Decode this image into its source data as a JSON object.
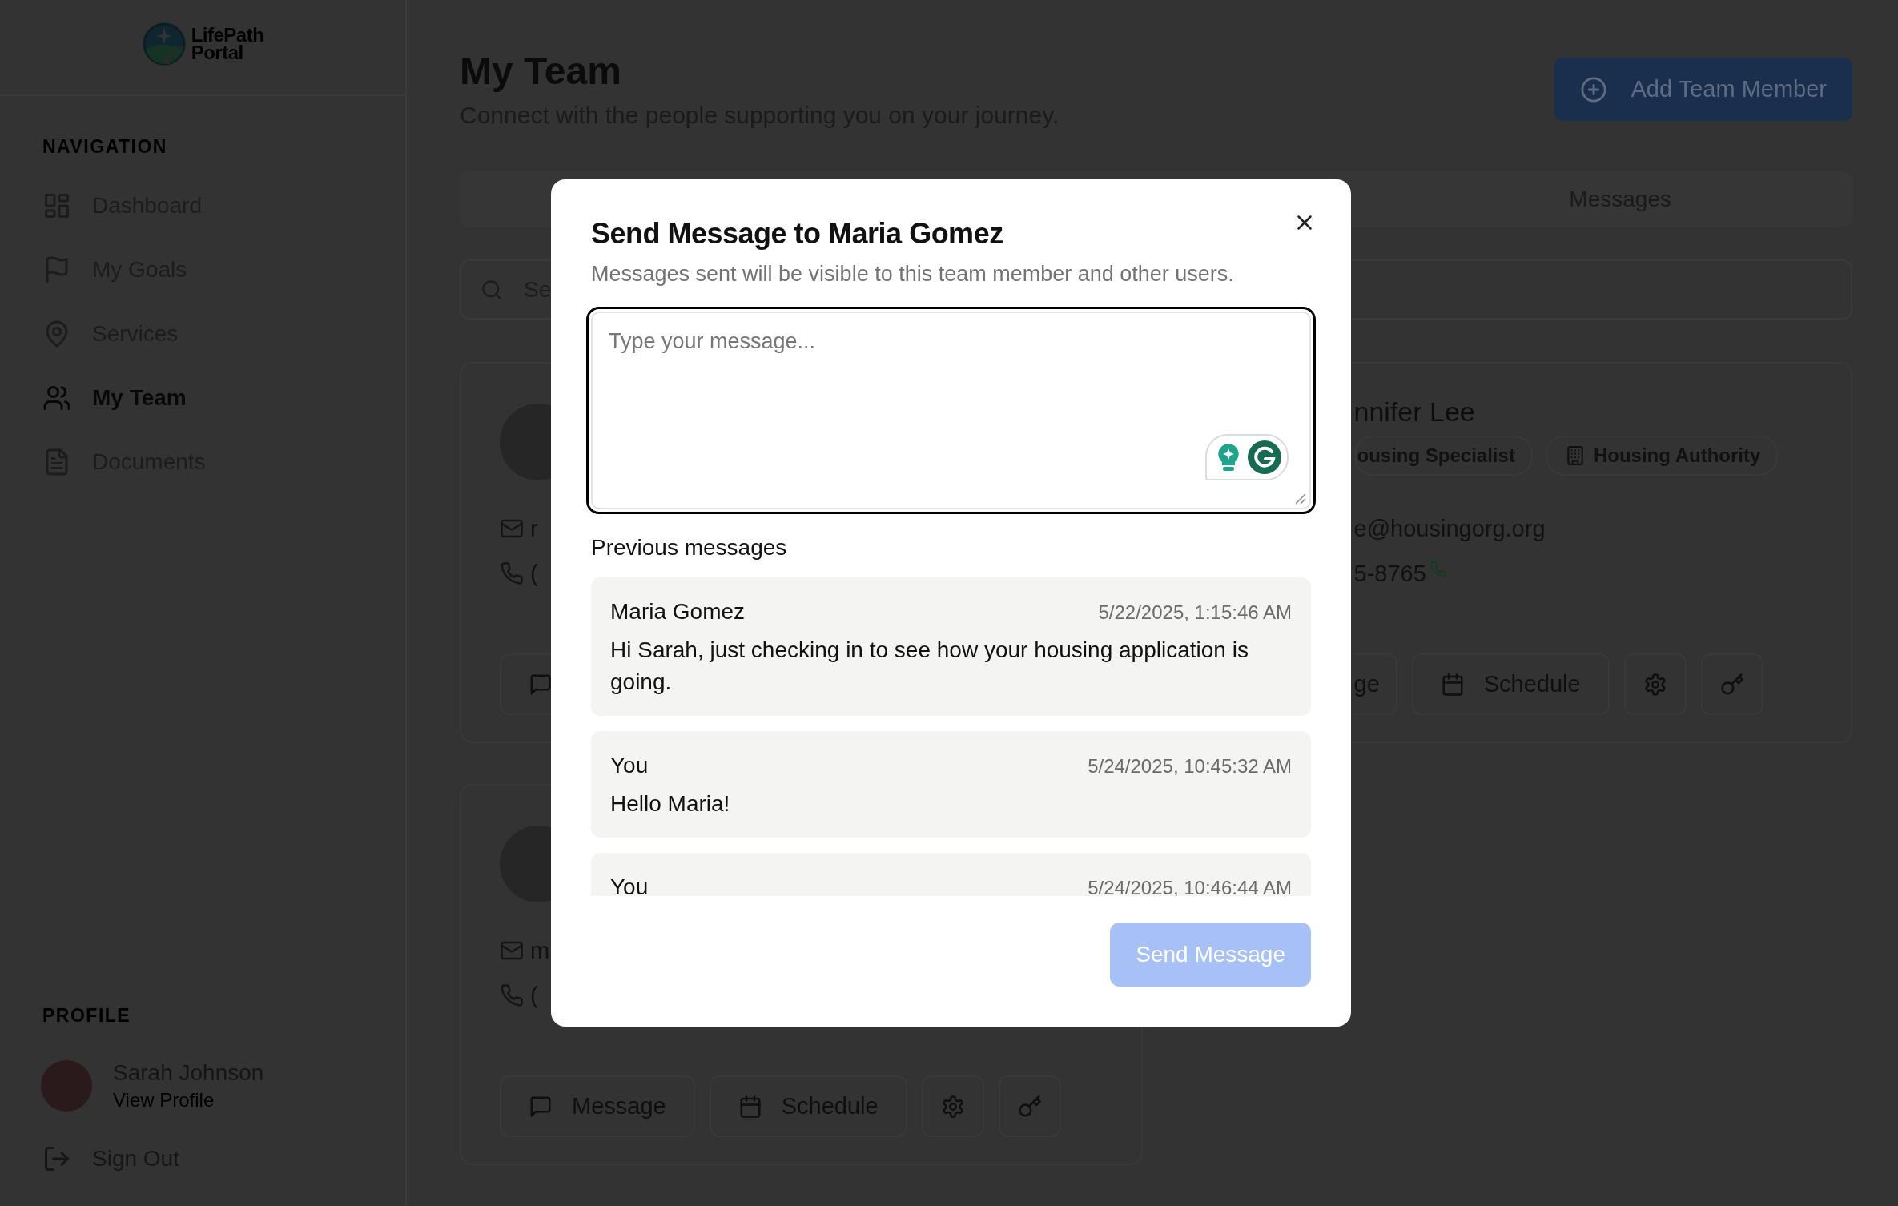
{
  "sidebar": {
    "logo": "LifePath Portal",
    "nav_heading": "NAVIGATION",
    "nav_items": [
      {
        "kind": "dashboard",
        "label": "Dashboard",
        "selected": false
      },
      {
        "kind": "goals",
        "label": "My Goals",
        "selected": false
      },
      {
        "kind": "services",
        "label": "Services",
        "selected": false
      },
      {
        "kind": "team",
        "label": "My Team",
        "selected": true
      },
      {
        "kind": "documents",
        "label": "Documents",
        "selected": false
      }
    ],
    "profile_heading": "PROFILE",
    "user": {
      "name": "Sarah Johnson",
      "link": "View Profile"
    },
    "sign_out": "Sign Out"
  },
  "header": {
    "title": "My Team",
    "subtitle": "Connect with the people supporting you on your journey.",
    "add_button": "Add Team Member"
  },
  "tabs": [
    {
      "label": "Messages",
      "selected": false
    }
  ],
  "search": {
    "placeholder": "Se"
  },
  "cards": [
    {
      "email": "r",
      "phone": "(",
      "actions": [
        {
          "kind": "message"
        }
      ]
    },
    {
      "name": "nnifer Lee",
      "badges": [
        {
          "kind": "role",
          "label": "ousing Specialist"
        },
        {
          "kind": "organization",
          "label": "Housing Authority"
        }
      ],
      "email": "e@housingorg.org",
      "phone": "5-8765",
      "callable": true,
      "actions": [
        {
          "kind": "message",
          "label": "ge"
        },
        {
          "kind": "schedule",
          "label": "Schedule"
        },
        {
          "kind": "settings"
        },
        {
          "kind": "key"
        }
      ]
    },
    {
      "email": "m",
      "phone": "(",
      "actions": [
        {
          "kind": "message",
          "label": "Message"
        },
        {
          "kind": "schedule",
          "label": "Schedule"
        },
        {
          "kind": "settings"
        },
        {
          "kind": "key"
        }
      ]
    }
  ],
  "dialog": {
    "title": "Send Message to Maria Gomez",
    "description": "Messages sent will be visible to this team member and other users.",
    "placeholder": "Type your message...",
    "history_heading": "Previous messages",
    "messages": [
      {
        "sender": "Maria Gomez",
        "time": "5/22/2025, 1:15:46 AM",
        "text": "Hi Sarah, just checking in to see how your housing application is going."
      },
      {
        "sender": "You",
        "time": "5/24/2025, 10:45:32 AM",
        "text": "Hello Maria!"
      },
      {
        "sender": "You",
        "time": "5/24/2025, 10:46:44 AM"
      }
    ],
    "send_button": {
      "label": "Send Message",
      "disabled": true
    }
  }
}
